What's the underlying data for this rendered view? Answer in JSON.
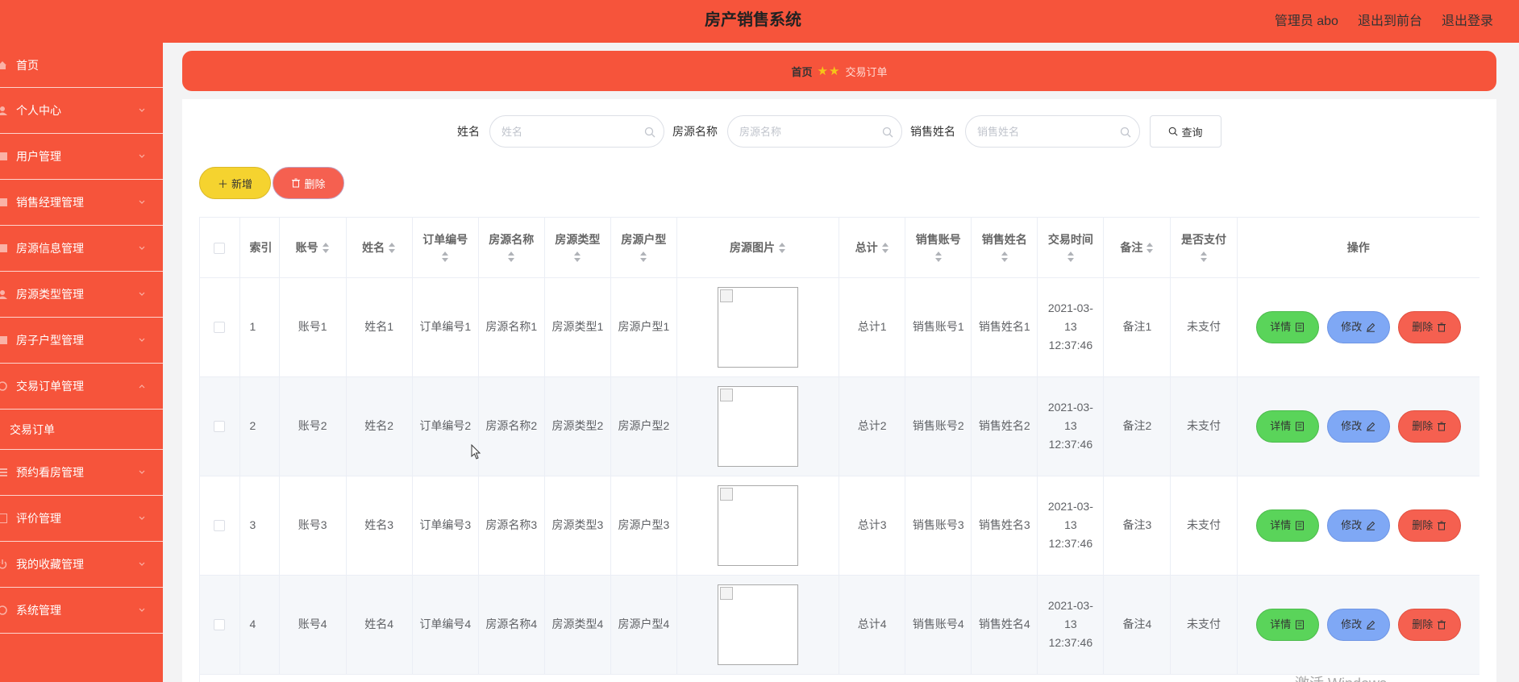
{
  "header": {
    "title": "房产销售系统",
    "links": [
      "管理员 abo",
      "退出到前台",
      "退出登录"
    ]
  },
  "sidebar": {
    "items": [
      {
        "label": "首页",
        "icon": "home-icon"
      },
      {
        "label": "个人中心",
        "icon": "user-icon"
      },
      {
        "label": "用户管理",
        "icon": "list-icon"
      },
      {
        "label": "销售经理管理",
        "icon": "list-icon"
      },
      {
        "label": "房源信息管理",
        "icon": "list-icon"
      },
      {
        "label": "房源类型管理",
        "icon": "user-icon"
      },
      {
        "label": "房子户型管理",
        "icon": "list-icon"
      },
      {
        "label": "交易订单管理",
        "icon": "circle-icon",
        "expanded": true
      },
      {
        "label": "预约看房管理",
        "icon": "list-icon"
      },
      {
        "label": "评价管理",
        "icon": "grid-icon"
      },
      {
        "label": "我的收藏管理",
        "icon": "power-icon"
      },
      {
        "label": "系统管理",
        "icon": "circle-icon"
      }
    ],
    "submenu": [
      "交易订单"
    ]
  },
  "breadcrumb": {
    "home": "首页",
    "current": "交易订单"
  },
  "search": {
    "fields": [
      {
        "label": "姓名",
        "placeholder": "姓名"
      },
      {
        "label": "房源名称",
        "placeholder": "房源名称"
      },
      {
        "label": "销售姓名",
        "placeholder": "销售姓名"
      }
    ],
    "query_label": "查询"
  },
  "actions": {
    "add_label": "新增",
    "delete_label": "删除"
  },
  "table": {
    "columns": [
      "索引",
      "账号",
      "姓名",
      "订单编号",
      "房源名称",
      "房源类型",
      "房源户型",
      "房源图片",
      "总计",
      "销售账号",
      "销售姓名",
      "交易时间",
      "备注",
      "是否支付",
      "操作"
    ],
    "rows": [
      {
        "index": "1",
        "account": "账号1",
        "name": "姓名1",
        "order_no": "订单编号1",
        "house_name": "房源名称1",
        "house_type": "房源类型1",
        "house_layout": "房源户型1",
        "total": "总计1",
        "sales_account": "销售账号1",
        "sales_name": "销售姓名1",
        "time": "2021-03-13 12:37:46",
        "remark": "备注1",
        "paid": "未支付"
      },
      {
        "index": "2",
        "account": "账号2",
        "name": "姓名2",
        "order_no": "订单编号2",
        "house_name": "房源名称2",
        "house_type": "房源类型2",
        "house_layout": "房源户型2",
        "total": "总计2",
        "sales_account": "销售账号2",
        "sales_name": "销售姓名2",
        "time": "2021-03-13 12:37:46",
        "remark": "备注2",
        "paid": "未支付"
      },
      {
        "index": "3",
        "account": "账号3",
        "name": "姓名3",
        "order_no": "订单编号3",
        "house_name": "房源名称3",
        "house_type": "房源类型3",
        "house_layout": "房源户型3",
        "total": "总计3",
        "sales_account": "销售账号3",
        "sales_name": "销售姓名3",
        "time": "2021-03-13 12:37:46",
        "remark": "备注3",
        "paid": "未支付"
      },
      {
        "index": "4",
        "account": "账号4",
        "name": "姓名4",
        "order_no": "订单编号4",
        "house_name": "房源名称4",
        "house_type": "房源类型4",
        "house_layout": "房源户型4",
        "total": "总计4",
        "sales_account": "销售账号4",
        "sales_name": "销售姓名4",
        "time": "2021-03-13 12:37:46",
        "remark": "备注4",
        "paid": "未支付"
      }
    ],
    "row_actions": {
      "detail": "详情",
      "edit": "修改",
      "delete": "删除"
    }
  },
  "watermark": "激活 Windows",
  "colors": {
    "brand": "#f6543b",
    "add_button": "#f5d32f",
    "delete_button": "#f56050",
    "detail_button": "#5ad45a",
    "edit_button": "#7fa8f5"
  }
}
